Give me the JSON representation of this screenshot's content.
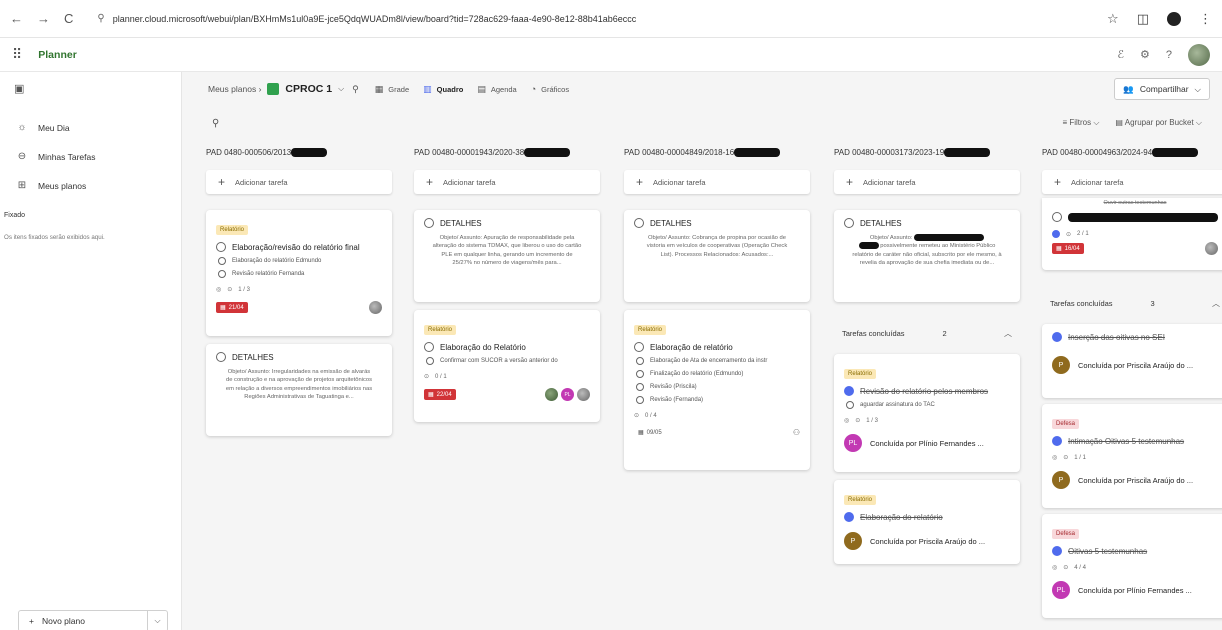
{
  "browser": {
    "url": "planner.cloud.microsoft/webui/plan/BXHmMs1ul0a9E-jce5QdqWUADm8l/view/board?tid=728ac629-faaa-4e90-8e12-88b41ab6eccc"
  },
  "app": {
    "title": "Planner"
  },
  "sidebar": {
    "my_day": "Meu Dia",
    "my_tasks": "Minhas Tarefas",
    "my_plans": "Meus planos",
    "pinned": "Fixado",
    "pinned_hint": "Os itens fixados serão exibidos aqui.",
    "new_plan": "Novo plano"
  },
  "toolbar": {
    "breadcrumb": "Meus planos",
    "plan_name": "CPROC 1",
    "tabs": [
      "Grade",
      "Quadro",
      "Agenda",
      "Gráficos"
    ],
    "share": "Compartilhar",
    "filters": "Filtros",
    "group_by": "Agrupar por Bucket"
  },
  "board": {
    "add_task": "Adicionar tarefa",
    "completed_label": "Tarefas concluídas",
    "columns": [
      {
        "title": "PAD 0480-000506/2013",
        "card1": {
          "tag": "Relatório",
          "title": "Elaboração/revisão do relatório final",
          "sub1": "Elaboração do relatório Edmundo",
          "sub2": "Revisão relatório Fernanda",
          "progress": "1 / 3",
          "due": "21/04"
        },
        "card2": {
          "title": "DETALHES",
          "desc": "Objeto/ Assunto: Irregularidades na emissão de alvarás de construção e na aprovação de projetos arquitetônicos em relação a diversos empreendimentos imobiliários nas Regiões Administrativas de Taguatinga e..."
        }
      },
      {
        "title": "PAD 00480-00001943/2020-38",
        "card1": {
          "title": "DETALHES",
          "desc": "Objeto/ Assunto: Apuração de responsabilidade pela alteração do sistema TDMAX, que liberou o uso do cartão PLE em qualquer linha, gerando um incremento de 25/27% no número de viagens/mês para..."
        },
        "card2": {
          "tag": "Relatório",
          "title": "Elaboração do Relatório",
          "sub1": "Confirmar com SUCOR a versão anterior do",
          "progress": "0 / 1",
          "due": "22/04",
          "avatar_initials": "PL"
        }
      },
      {
        "title": "PAD 00480-00004849/2018-16",
        "card1": {
          "title": "DETALHES",
          "desc": "Objeto/ Assunto: Cobrança de propina por ocasião de vistoria em veículos de cooperativas (Operação Check List). Processos Relacionados: Acusados:..."
        },
        "card2": {
          "tag": "Relatório",
          "title": "Elaboração de relatório",
          "sub1": "Elaboração de Ata de encerramento da instr",
          "sub2": "Finalização do relatório (Edmundo)",
          "sub3": "Revisão (Priscila)",
          "sub4": "Revisão (Fernanda)",
          "progress": "0 / 4",
          "due": "09/05"
        }
      },
      {
        "title": "PAD 00480-00003173/2023-19",
        "card1": {
          "title": "DETALHES",
          "desc_a": "Objeto/ Assunto:",
          "desc_b": "possivelmente remeteu ao Ministério Público relatório de caráter não oficial, subscrito por ele mesmo, à revelia da aprovação de sua chefia imediata ou de..."
        },
        "completed_count": "2",
        "done1": {
          "tag": "Relatório",
          "title": "Revisão do relatório pelos membros",
          "sub1": "aguardar assinatura do TAC",
          "progress": "1 / 3",
          "initials": "PL",
          "completed_by": "Concluída por Plínio Fernandes ..."
        },
        "done2": {
          "tag": "Relatório",
          "title": "Elaboração do relatório",
          "initials": "P",
          "completed_by": "Concluída por Priscila Araújo do ..."
        }
      },
      {
        "title": "PAD 00480-00004963/2024-94",
        "top_card": {
          "partial_text": "Ouvir outras testemunhas",
          "progress": "2 / 1",
          "due": "16/04"
        },
        "completed_count": "3",
        "done1": {
          "title": "Inserção das oitivas no SEI",
          "initials": "P",
          "completed_by": "Concluída por Priscila Araújo do ..."
        },
        "done2": {
          "tag": "Defesa",
          "title": "Intimação Oitivas 5 testemunhas",
          "progress": "1 / 1",
          "initials": "P",
          "completed_by": "Concluída por Priscila Araújo do ..."
        },
        "done3": {
          "tag": "Defesa",
          "title": "Oitivas 5 testemunhas",
          "progress": "4 / 4",
          "initials": "PL",
          "completed_by": "Concluída por Plínio Fernandes ..."
        }
      }
    ]
  }
}
